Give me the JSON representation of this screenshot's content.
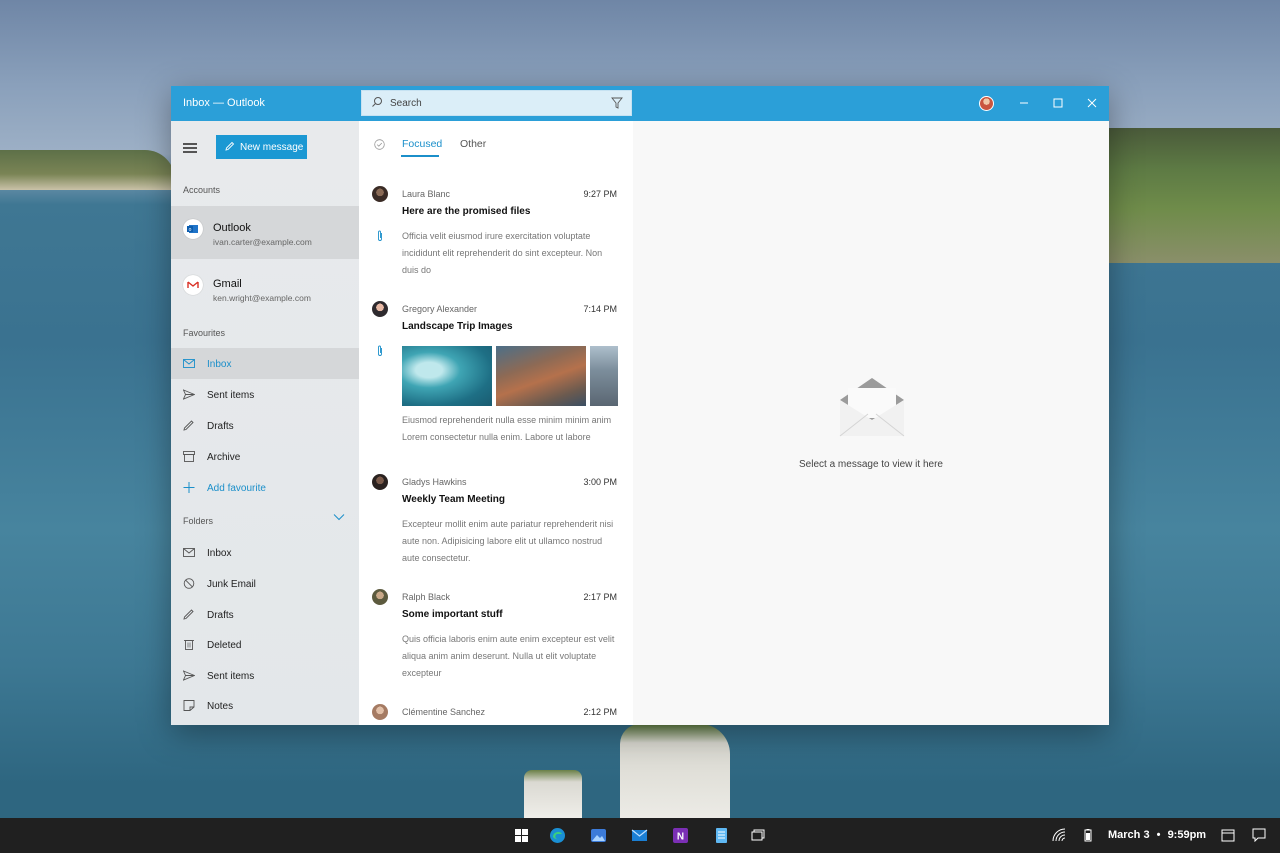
{
  "window": {
    "title": "Inbox — Outlook",
    "accent_color": "#2b9fd8"
  },
  "search": {
    "placeholder": "Search"
  },
  "sidebar": {
    "new_message_label": "New message",
    "accounts_label": "Accounts",
    "accounts": [
      {
        "name": "Outlook",
        "email": "ivan.carter@example.com",
        "icon": "outlook-icon",
        "selected": true
      },
      {
        "name": "Gmail",
        "email": "ken.wright@example.com",
        "icon": "gmail-icon",
        "selected": false
      }
    ],
    "favourites_label": "Favourites",
    "favourites": [
      {
        "label": "Inbox",
        "icon": "mail-icon",
        "selected": true
      },
      {
        "label": "Sent items",
        "icon": "send-icon"
      },
      {
        "label": "Drafts",
        "icon": "pencil-icon"
      },
      {
        "label": "Archive",
        "icon": "archive-icon"
      },
      {
        "label": "Add favourite",
        "icon": "plus-icon"
      }
    ],
    "folders_label": "Folders",
    "folders": [
      {
        "label": "Inbox",
        "icon": "mail-icon"
      },
      {
        "label": "Junk Email",
        "icon": "block-icon"
      },
      {
        "label": "Drafts",
        "icon": "pencil-icon"
      },
      {
        "label": "Deleted",
        "icon": "trash-icon"
      },
      {
        "label": "Sent items",
        "icon": "send-icon"
      },
      {
        "label": "Notes",
        "icon": "note-icon"
      }
    ]
  },
  "list": {
    "tabs": [
      "Focused",
      "Other"
    ],
    "active_tab": "Focused",
    "messages": [
      {
        "sender": "Laura Blanc",
        "time": "9:27 PM",
        "subject": "Here are the promised files",
        "preview": "Officia velit eiusmod irure exercitation voluptate incididunt elit reprehenderit do sint excepteur. Non duis do",
        "attachment": true
      },
      {
        "sender": "Gregory Alexander",
        "time": "7:14 PM",
        "subject": "Landscape Trip Images",
        "preview": "Eiusmod reprehenderit nulla esse minim minim anim Lorem consectetur nulla enim. Labore ut labore",
        "attachment": true,
        "images": [
          "ocean-waves",
          "coastal-town",
          "city-skyline"
        ]
      },
      {
        "sender": "Gladys Hawkins",
        "time": "3:00 PM",
        "subject": "Weekly Team Meeting",
        "preview": "Excepteur mollit enim aute pariatur reprehenderit nisi aute non. Adipisicing labore elit ut ullamco nostrud aute consectetur."
      },
      {
        "sender": "Ralph Black",
        "time": "2:17 PM",
        "subject": "Some important stuff",
        "preview": "Quis officia laboris enim aute enim excepteur est velit aliqua anim anim deserunt. Nulla ut elit voluptate excepteur"
      },
      {
        "sender": "Clémentine Sanchez",
        "time": "2:12 PM"
      }
    ]
  },
  "reading_pane": {
    "empty_text": "Select a message to view it here"
  },
  "taskbar": {
    "apps": [
      "start-icon",
      "edge-icon",
      "photos-icon",
      "mail-icon",
      "onenote-icon",
      "notepad-icon",
      "task-view-icon"
    ],
    "date": "March 3",
    "separator": "•",
    "time": "9:59pm"
  }
}
